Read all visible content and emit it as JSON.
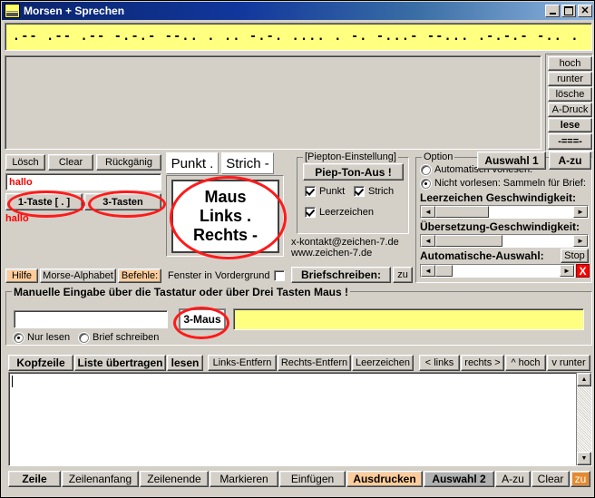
{
  "window": {
    "title": "Morsen + Sprechen",
    "icon": "app-window-icon",
    "minimize": "_",
    "maximize": "□",
    "close": "✕"
  },
  "morse_display": {
    "text": ".-- .-- .-- -.-.- --.. . .. -.-. .... . -. -...- --... .-.-.- -.. ."
  },
  "right_column": {
    "buttons": [
      {
        "label": "hoch",
        "bold": false
      },
      {
        "label": "runter",
        "bold": false
      },
      {
        "label": "lösche",
        "bold": false
      },
      {
        "label": "A-Druck",
        "bold": false
      },
      {
        "label": "lese",
        "bold": true
      },
      {
        "label": "-===-",
        "bold": true
      }
    ]
  },
  "edit_toolbar": {
    "buttons": [
      "Lösch",
      "Clear",
      "Rückgänig"
    ]
  },
  "input_line": {
    "value": "hallo"
  },
  "key_buttons": {
    "one_key": "1-Taste [ . ]",
    "three_key": "3-Tasten"
  },
  "decoded_text": "hallo",
  "help_bar": {
    "hilfe": "Hilfe",
    "alphabet": "Morse-Alphabet",
    "befehle": "Befehle:"
  },
  "tabs": {
    "punkt": "Punkt .",
    "strich": "Strich -"
  },
  "mouse_panel": {
    "line1": "Maus",
    "line2": "Links .",
    "line3": "Rechts -"
  },
  "foreground": {
    "label": "Fenster in Vordergrund",
    "checked": false
  },
  "piepton": {
    "group_label": "[Piepton-Einstellung]",
    "button": "Piep-Ton-Aus !",
    "checks": [
      {
        "label": "Punkt",
        "checked": true
      },
      {
        "label": "Strich",
        "checked": true
      },
      {
        "label": "Leerzeichen",
        "checked": true
      }
    ]
  },
  "contact": {
    "email": "x-kontakt@zeichen-7.de",
    "website": "www.zeichen-7.de",
    "brief_button": "Briefschreiben:",
    "zu_button": "zu"
  },
  "option": {
    "group_label": "Option",
    "auswahl1": "Auswahl 1",
    "azu": "A-zu",
    "radios": [
      {
        "label": "Automatisch vorlesen:",
        "selected": false
      },
      {
        "label": "Nicht vorlesen: Sammeln für Brief:",
        "selected": true
      }
    ],
    "slider1_label": "Leerzeichen Geschwindigkeit:",
    "slider2_label": "Übersetzung-Geschwindigkeit:",
    "slider3_label": "Automatische-Auswahl:",
    "stop_button": "Stop",
    "cancel_button": "X",
    "arrow_left": "◄",
    "arrow_right": "►"
  },
  "manual_input": {
    "group_label": "Manuelle Eingabe über die Tastatur oder über Drei Tasten Maus !",
    "field_value": "",
    "maus_button": "3-Maus",
    "radios": [
      {
        "label": "Nur lesen",
        "selected": true
      },
      {
        "label": "Brief schreiben",
        "selected": false
      }
    ]
  },
  "text_toolbar": {
    "buttons": [
      {
        "label": "Kopfzeile",
        "bold": true
      },
      {
        "label": "Liste übertragen",
        "bold": true
      },
      {
        "label": "lesen",
        "bold": true
      },
      {
        "label": "Links-Entfern",
        "bold": false
      },
      {
        "label": "Rechts-Entfern",
        "bold": false
      },
      {
        "label": "Leerzeichen",
        "bold": false
      },
      {
        "label": "< links",
        "bold": false
      },
      {
        "label": "rechts >",
        "bold": false
      },
      {
        "label": "^ hoch",
        "bold": false
      },
      {
        "label": "v runter",
        "bold": false
      }
    ]
  },
  "textarea": {
    "value": ""
  },
  "bottom_toolbar": {
    "buttons": [
      {
        "label": "Zeile",
        "bold": true,
        "style": "normal"
      },
      {
        "label": "Zeilenanfang",
        "bold": false,
        "style": "normal"
      },
      {
        "label": "Zeilenende",
        "bold": false,
        "style": "normal"
      },
      {
        "label": "Markieren",
        "bold": false,
        "style": "normal"
      },
      {
        "label": "Einfügen",
        "bold": false,
        "style": "normal"
      },
      {
        "label": "Ausdrucken",
        "bold": true,
        "style": "orange"
      },
      {
        "label": "Auswahl 2",
        "bold": true,
        "style": "grey"
      },
      {
        "label": "A-zu",
        "bold": false,
        "style": "normal"
      },
      {
        "label": "Clear",
        "bold": false,
        "style": "normal"
      },
      {
        "label": "zu",
        "bold": false,
        "style": "orange-strong"
      }
    ]
  },
  "colors": {
    "title_bar": "#0a246a",
    "face": "#d4d0c8",
    "yellow": "#ffff80",
    "accent_red": "#ff0000",
    "orange": "#ffcc99"
  }
}
